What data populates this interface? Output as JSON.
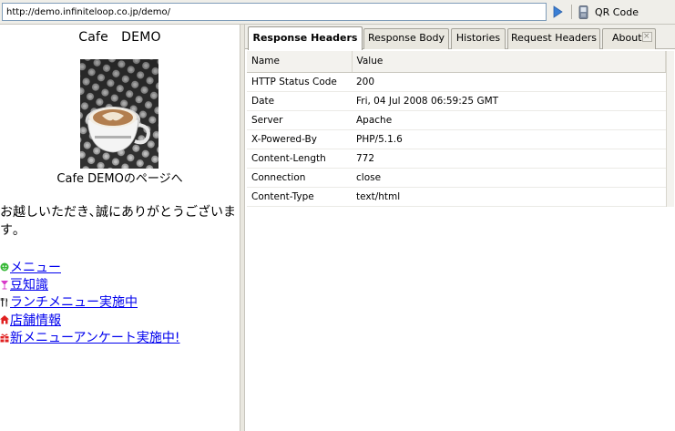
{
  "address_bar": {
    "url": "http://demo.infiniteloop.co.jp/demo/",
    "go_icon": "go-arrow-icon",
    "qr_icon": "mobile-phone-icon",
    "qr_label": "QR Code"
  },
  "preview": {
    "title": "Cafe　DEMO",
    "photo_caption": "Cafe DEMOのページへ",
    "welcome": "お越しいただき､誠にありがとうございます｡",
    "menu": [
      {
        "icon": "green-face-icon",
        "label": "メニュー"
      },
      {
        "icon": "cocktail-glass-icon",
        "label": "豆知識"
      },
      {
        "icon": "fork-knife-icon",
        "label": "ランチメニュー実施中"
      },
      {
        "icon": "house-icon",
        "label": "店舗情報"
      },
      {
        "icon": "gift-icon",
        "label": "新メニューアンケート実施中!"
      }
    ]
  },
  "tabs": [
    {
      "label": "Response Headers",
      "active": true
    },
    {
      "label": "Response Body",
      "active": false
    },
    {
      "label": "Histories",
      "active": false
    },
    {
      "label": "Request Headers",
      "active": false
    },
    {
      "label": "About",
      "active": false,
      "close": "×"
    }
  ],
  "headers_table": {
    "columns": [
      "Name",
      "Value"
    ],
    "rows": [
      [
        "HTTP Status Code",
        "200"
      ],
      [
        "Date",
        "Fri, 04 Jul 2008 06:59:25 GMT"
      ],
      [
        "Server",
        "Apache"
      ],
      [
        "X-Powered-By",
        "PHP/5.1.6"
      ],
      [
        "Content-Length",
        "772"
      ],
      [
        "Connection",
        "close"
      ],
      [
        "Content-Type",
        "text/html"
      ]
    ]
  },
  "colors": {
    "chrome_bg": "#efeee9",
    "link": "#0000ee",
    "go_arrow": "#3a7fd5"
  }
}
